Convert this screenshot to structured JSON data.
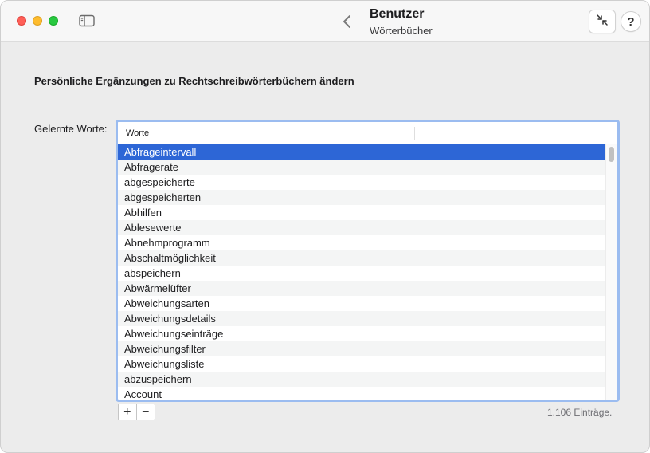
{
  "window": {
    "title": "Benutzer",
    "subtitle": "Wörterbücher"
  },
  "toolbar": {
    "sidebar_icon": "sidebar-icon",
    "back_icon": "chevron-left-icon",
    "shrink_icon": "arrows-shrink-icon",
    "help_label": "?"
  },
  "main": {
    "heading": "Persönliche Ergänzungen zu Rechtschreibwörterbüchern ändern",
    "field_label": "Gelernte Worte:",
    "table": {
      "column_header": "Worte",
      "selected_index": 0,
      "rows": [
        "Abfrageintervall",
        "Abfragerate",
        "abgespeicherte",
        "abgespeicherten",
        "Abhilfen",
        "Ablesewerte",
        "Abnehmprogramm",
        "Abschaltmöglichkeit",
        "abspeichern",
        "Abwärmelüfter",
        "Abweichungsarten",
        "Abweichungsdetails",
        "Abweichungseinträge",
        "Abweichungsfilter",
        "Abweichungsliste",
        "abzuspeichern",
        "Account"
      ]
    },
    "add_label": "+",
    "remove_label": "−",
    "entry_count": "1.106 Einträge."
  },
  "colors": {
    "selection": "#2d66d6",
    "focus_ring": "#9bbcf0",
    "close": "#ff5f57",
    "minimize": "#febc2e",
    "maximize": "#28c840"
  }
}
